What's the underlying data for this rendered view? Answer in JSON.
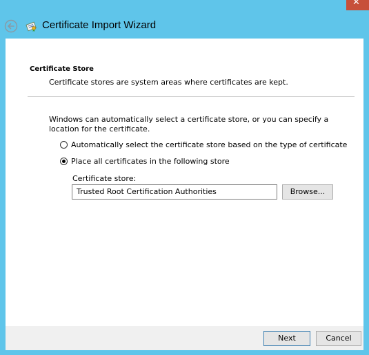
{
  "window": {
    "title": "Certificate Import Wizard",
    "close_glyph": "✕",
    "accent_color": "#5fc5ea",
    "close_color": "#c7503a",
    "back_icon": "back-arrow-icon",
    "title_icon": "certificate-icon"
  },
  "section": {
    "heading": "Certificate Store",
    "subheading": "Certificate stores are system areas where certificates are kept."
  },
  "intro_text": "Windows can automatically select a certificate store, or you can specify a location for the certificate.",
  "options": [
    {
      "label": "Automatically select the certificate store based on the type of certificate",
      "selected": false
    },
    {
      "label": "Place all certificates in the following store",
      "selected": true
    }
  ],
  "store": {
    "label": "Certificate store:",
    "value": "Trusted Root Certification Authorities",
    "browse_label": "Browse..."
  },
  "footer": {
    "next_label": "Next",
    "cancel_label": "Cancel"
  }
}
